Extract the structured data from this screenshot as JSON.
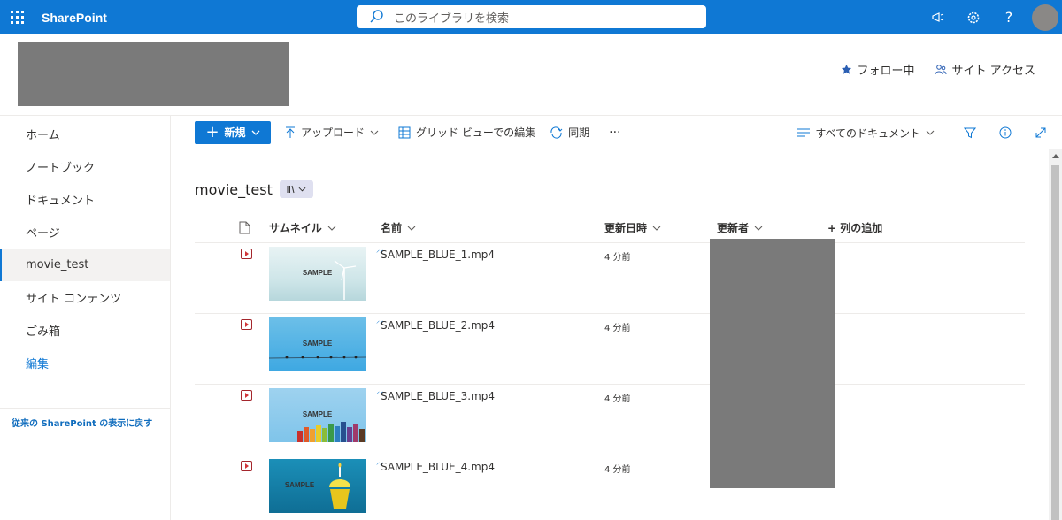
{
  "suite": {
    "brand": "SharePoint",
    "search_placeholder": "このライブラリを検索"
  },
  "site": {
    "follow_label": "フォロー中",
    "access_label": "サイト アクセス"
  },
  "nav": {
    "items": [
      {
        "label": "ホーム"
      },
      {
        "label": "ノートブック"
      },
      {
        "label": "ドキュメント"
      },
      {
        "label": "ページ"
      },
      {
        "label": "movie_test"
      },
      {
        "label": "サイト コンテンツ"
      },
      {
        "label": "ごみ箱"
      }
    ],
    "edit_label": "編集",
    "footer_link": "従来の SharePoint の表示に戻す"
  },
  "commands": {
    "new_label": "新規",
    "upload_label": "アップロード",
    "grid_label": "グリッド ビューでの編集",
    "sync_label": "同期",
    "more_label": "···",
    "view_label": "すべてのドキュメント"
  },
  "library": {
    "title": "movie_test",
    "columns": {
      "thumbnail": "サムネイル",
      "name": "名前",
      "modified": "更新日時",
      "modified_by": "更新者",
      "add_column": "+ 列の追加"
    },
    "files": [
      {
        "name": "SAMPLE_BLUE_1.mp4",
        "modified": "4 分前",
        "thumb_label": "SAMPLE"
      },
      {
        "name": "SAMPLE_BLUE_2.mp4",
        "modified": "4 分前",
        "thumb_label": "SAMPLE"
      },
      {
        "name": "SAMPLE_BLUE_3.mp4",
        "modified": "4 分前",
        "thumb_label": "SAMPLE"
      },
      {
        "name": "SAMPLE_BLUE_4.mp4",
        "modified": "4 分前",
        "thumb_label": "SAMPLE"
      }
    ]
  },
  "colors": {
    "accent": "#0f78d4",
    "redacted": "#7a7a7a"
  }
}
